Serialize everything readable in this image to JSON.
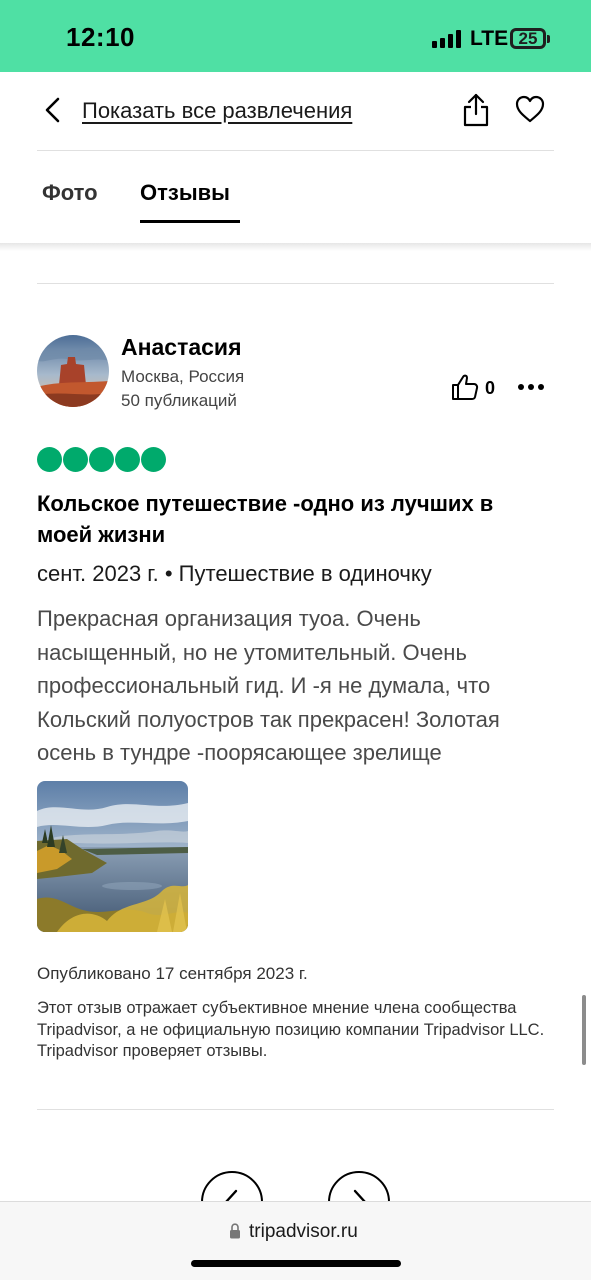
{
  "status_bar": {
    "time": "12:10",
    "network": "LTE",
    "battery": "25",
    "background_color": "#4fe0a4"
  },
  "header": {
    "back_icon": "chevron-left-icon",
    "back_link_label": "Показать все развлечения",
    "share_icon": "share-icon",
    "favorite_icon": "heart-icon"
  },
  "tabs": [
    {
      "label": "Фото",
      "active": false
    },
    {
      "label": "Отзывы",
      "active": true
    }
  ],
  "review": {
    "author": {
      "name": "Анастасия",
      "location": "Москва, Россия",
      "posts": "50 публикаций",
      "avatar": "avatar-desert-butte"
    },
    "likes": "0",
    "like_icon": "thumbs-up-icon",
    "more_icon": "more-dots-icon",
    "rating": 5,
    "rating_max": 5,
    "rating_color": "#00aa6c",
    "title": "Кольское путешествие -одно из лучших в моей жизни",
    "meta": "сент. 2023 г. • Путешествие в одиночку",
    "text": "Прекрасная организация туоа. Очень насыщенный, но не утомительный. Очень профессиональный гид. И -я не думала, что Кольский полуостров так прекрасен! Золотая осень в тундре -поорясающее зрелище",
    "photo": "autumn-tundra-lake-photo",
    "published": "Опубликовано 17 сентября 2023 г.",
    "disclaimer": "Этот отзыв отражает субъективное мнение члена сообщества Tripadvisor, а не официальную позицию компании Tripadvisor LLC. Tripadvisor проверяет отзывы."
  },
  "pagination": {
    "prev_icon": "chevron-left-icon",
    "next_icon": "chevron-right-icon"
  },
  "browser": {
    "lock_icon": "lock-icon",
    "url": "tripadvisor.ru"
  }
}
